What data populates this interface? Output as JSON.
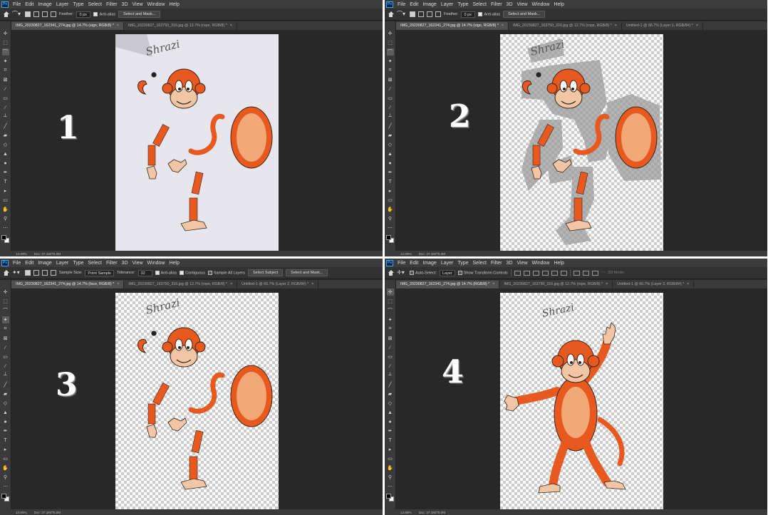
{
  "menu": [
    "File",
    "Edit",
    "Image",
    "Layer",
    "Type",
    "Select",
    "Filter",
    "3D",
    "View",
    "Window",
    "Help"
  ],
  "app_logo": "Ps",
  "colors": {
    "monkey": "#e8591f",
    "belly": "#f2a877",
    "face": "#f1c6a6",
    "outline": "#3a2418"
  },
  "panes": [
    {
      "step": "1",
      "options": {
        "feather_label": "Feather:",
        "feather_value": "0 px",
        "antialias_label": "Anti-alias",
        "select_mask_label": "Select and Mask..."
      },
      "tabs": [
        {
          "label": "IMG_20230827_162341_274.jpg @ 14.7% (sign, RGB/8) *",
          "close": "×"
        },
        {
          "label": "IMG_20230827_163750_316.jpg @ 12.7% (rope, RGB/8) *",
          "close": "×"
        }
      ],
      "status": {
        "zoom": "14.69%",
        "doc": "Doc: 37.1M/75.0M"
      }
    },
    {
      "step": "2",
      "options": {
        "feather_label": "Feather:",
        "feather_value": "0 px",
        "antialias_label": "Anti-alias",
        "select_mask_label": "Select and Mask..."
      },
      "tabs": [
        {
          "label": "IMG_20230827_162341_274.jpg @ 14.7% (sign, RGB/8) *",
          "close": "×"
        },
        {
          "label": "IMG_20230827_163750_316.jpg @ 12.7% (rope, RGB/8) *",
          "close": "×"
        },
        {
          "label": "Untitled-1 @ 66.7% (Layer 1, RGB/8#) *",
          "close": "×"
        }
      ],
      "status": {
        "zoom": "14.69%",
        "doc": "Doc: 37.1M/75.0M"
      }
    },
    {
      "step": "3",
      "options": {
        "sample_size_label": "Sample Size:",
        "sample_size_value": "Point Sample",
        "tolerance_label": "Tolerance:",
        "tolerance_value": "32",
        "antialias_label": "Anti-alias",
        "contiguous_label": "Contiguous",
        "sample_all_label": "Sample All Layers",
        "select_subject_label": "Select Subject",
        "select_mask_label": "Select and Mask..."
      },
      "tabs": [
        {
          "label": "IMG_20230827_162341_274.jpg @ 14.7% (face, RGB/8) *",
          "close": "×"
        },
        {
          "label": "IMG_20230827_163750_316.jpg @ 12.7% (rope, RGB/8) *",
          "close": "×"
        },
        {
          "label": "Untitled-1 @ 66.7% (Layer 2, RGB/8#) *",
          "close": "×"
        }
      ],
      "status": {
        "zoom": "14.69%",
        "doc": "Doc: 37.1M/75.0M"
      }
    },
    {
      "step": "4",
      "options": {
        "auto_select_label": "Auto-Select:",
        "layer_value": "Layer",
        "transform_label": "Show Transform Controls",
        "mode_label": "3D Mode:"
      },
      "tabs": [
        {
          "label": "IMG_20230827_162341_274.jpg @ 14.7% (RGB/8) *",
          "close": "×"
        },
        {
          "label": "IMG_20230827_163750_316.jpg @ 12.7% (rope, RGB/8) *",
          "close": "×"
        },
        {
          "label": "Untitled-1 @ 66.7% (Layer 3, RGB/8#) *",
          "close": "×"
        }
      ],
      "status": {
        "zoom": "14.69%",
        "doc": "Doc: 37.1M/75.0M"
      }
    }
  ],
  "signature": "Shrazi"
}
